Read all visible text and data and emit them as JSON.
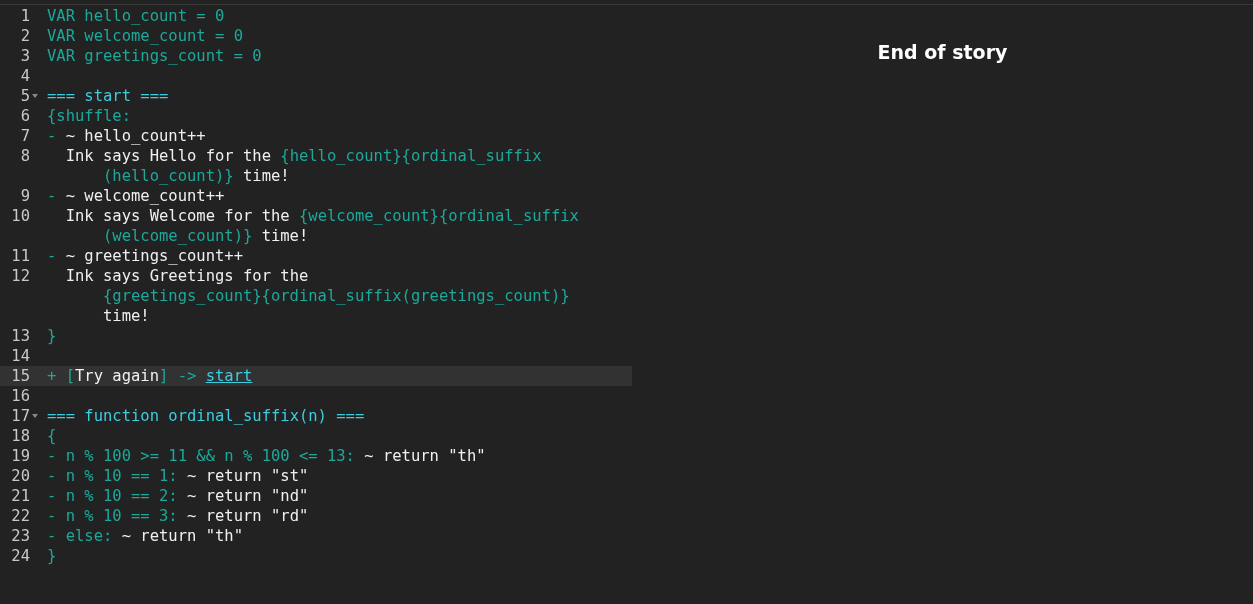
{
  "editor": {
    "lines": [
      {
        "number": "1",
        "foldable": false,
        "current": false,
        "rows": [
          {
            "segments": [
              {
                "kind": "logic",
                "text": "VAR hello_count = 0"
              }
            ]
          }
        ]
      },
      {
        "number": "2",
        "foldable": false,
        "current": false,
        "rows": [
          {
            "segments": [
              {
                "kind": "logic",
                "text": "VAR welcome_count = 0"
              }
            ]
          }
        ]
      },
      {
        "number": "3",
        "foldable": false,
        "current": false,
        "rows": [
          {
            "segments": [
              {
                "kind": "logic",
                "text": "VAR greetings_count = 0"
              }
            ]
          }
        ]
      },
      {
        "number": "4",
        "foldable": false,
        "current": false
      },
      {
        "number": "5",
        "foldable": true,
        "current": false,
        "rows": [
          {
            "segments": [
              {
                "kind": "knot",
                "text": "=== start ==="
              }
            ]
          }
        ]
      },
      {
        "number": "6",
        "foldable": false,
        "current": false,
        "rows": [
          {
            "segments": [
              {
                "kind": "logic",
                "text": "{shuffle:"
              }
            ]
          }
        ]
      },
      {
        "number": "7",
        "foldable": false,
        "current": false,
        "rows": [
          {
            "segments": [
              {
                "kind": "logic",
                "text": "- "
              },
              {
                "kind": "text",
                "text": "~ hello_count++"
              }
            ]
          }
        ]
      },
      {
        "number": "8",
        "foldable": false,
        "current": false,
        "rows": [
          {
            "segments": [
              {
                "kind": "text",
                "text": "  Ink says Hello for the "
              },
              {
                "kind": "logic",
                "text": "{hello_count}{ordinal_suffix"
              }
            ]
          },
          {
            "segments": [
              {
                "kind": "logic",
                "text": "(hello_count)}"
              },
              {
                "kind": "text",
                "text": " time!"
              }
            ]
          }
        ]
      },
      {
        "number": "9",
        "foldable": false,
        "current": false,
        "rows": [
          {
            "segments": [
              {
                "kind": "logic",
                "text": "- "
              },
              {
                "kind": "text",
                "text": "~ welcome_count++"
              }
            ]
          }
        ]
      },
      {
        "number": "10",
        "foldable": false,
        "current": false,
        "rows": [
          {
            "segments": [
              {
                "kind": "text",
                "text": "  Ink says Welcome for the "
              },
              {
                "kind": "logic",
                "text": "{welcome_count}{ordinal_suffix"
              }
            ]
          },
          {
            "segments": [
              {
                "kind": "logic",
                "text": "(welcome_count)}"
              },
              {
                "kind": "text",
                "text": " time!"
              }
            ]
          }
        ]
      },
      {
        "number": "11",
        "foldable": false,
        "current": false,
        "rows": [
          {
            "segments": [
              {
                "kind": "logic",
                "text": "- "
              },
              {
                "kind": "text",
                "text": "~ greetings_count++"
              }
            ]
          }
        ]
      },
      {
        "number": "12",
        "foldable": false,
        "current": false,
        "rows": [
          {
            "segments": [
              {
                "kind": "text",
                "text": "  Ink says Greetings for the"
              }
            ]
          },
          {
            "segments": [
              {
                "kind": "logic",
                "text": "{greetings_count}{ordinal_suffix(greetings_count)}"
              }
            ]
          },
          {
            "segments": [
              {
                "kind": "text",
                "text": "time!"
              }
            ]
          }
        ]
      },
      {
        "number": "13",
        "foldable": false,
        "current": false,
        "rows": [
          {
            "segments": [
              {
                "kind": "logic",
                "text": "}"
              }
            ]
          }
        ]
      },
      {
        "number": "14",
        "foldable": false,
        "current": false
      },
      {
        "number": "15",
        "foldable": false,
        "current": true,
        "rows": [
          {
            "segments": [
              {
                "kind": "logic",
                "text": "+ ["
              },
              {
                "kind": "text",
                "text": "Try again"
              },
              {
                "kind": "logic",
                "text": "] -> "
              },
              {
                "kind": "link",
                "text": "start"
              }
            ]
          }
        ]
      },
      {
        "number": "16",
        "foldable": false,
        "current": false
      },
      {
        "number": "17",
        "foldable": true,
        "current": false,
        "rows": [
          {
            "segments": [
              {
                "kind": "knot",
                "text": "=== function ordinal_suffix(n) ==="
              }
            ]
          }
        ]
      },
      {
        "number": "18",
        "foldable": false,
        "current": false,
        "rows": [
          {
            "segments": [
              {
                "kind": "logic",
                "text": "{"
              }
            ]
          }
        ]
      },
      {
        "number": "19",
        "foldable": false,
        "current": false,
        "rows": [
          {
            "segments": [
              {
                "kind": "logic",
                "text": "- n % 100 >= 11 && n % 100 <= 13: "
              },
              {
                "kind": "text",
                "text": "~ return \"th\""
              }
            ]
          }
        ]
      },
      {
        "number": "20",
        "foldable": false,
        "current": false,
        "rows": [
          {
            "segments": [
              {
                "kind": "logic",
                "text": "- n % 10 == 1: "
              },
              {
                "kind": "text",
                "text": "~ return \"st\""
              }
            ]
          }
        ]
      },
      {
        "number": "21",
        "foldable": false,
        "current": false,
        "rows": [
          {
            "segments": [
              {
                "kind": "logic",
                "text": "- n % 10 == 2: "
              },
              {
                "kind": "text",
                "text": "~ return \"nd\""
              }
            ]
          }
        ]
      },
      {
        "number": "22",
        "foldable": false,
        "current": false,
        "rows": [
          {
            "segments": [
              {
                "kind": "logic",
                "text": "- n % 10 == 3: "
              },
              {
                "kind": "text",
                "text": "~ return \"rd\""
              }
            ]
          }
        ]
      },
      {
        "number": "23",
        "foldable": false,
        "current": false,
        "rows": [
          {
            "segments": [
              {
                "kind": "logic",
                "text": "- else: "
              },
              {
                "kind": "text",
                "text": "~ return \"th\""
              }
            ]
          }
        ]
      },
      {
        "number": "24",
        "foldable": false,
        "current": false,
        "rows": [
          {
            "segments": [
              {
                "kind": "logic",
                "text": "}"
              }
            ]
          }
        ]
      }
    ]
  },
  "player": {
    "end_message": "End of story"
  }
}
